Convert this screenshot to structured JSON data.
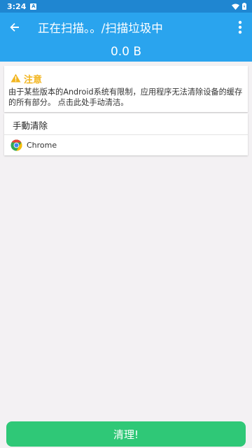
{
  "status_bar": {
    "time": "3:24",
    "notification_letter": "A",
    "icons": [
      "wifi-icon",
      "battery-icon"
    ]
  },
  "app_bar": {
    "title": "正在扫描。。/扫描垃圾中",
    "scan_size": "0.0 B",
    "background_color": "#2aa4ee",
    "icons": [
      "back-arrow-icon",
      "more-vert-icon"
    ]
  },
  "notice": {
    "title": "注意",
    "body": "由于某些版本的Android系统有限制，应用程序无法清除设备的缓存的所有部分。 点击此处手动清洁。",
    "icon": "warning-icon",
    "accent_color": "#f2b51f"
  },
  "manual_clean": {
    "title": "手動清除",
    "apps": [
      {
        "name": "Chrome",
        "icon": "chrome-icon"
      }
    ]
  },
  "footer": {
    "clean_label": "清理!",
    "button_color": "#2fc877"
  }
}
